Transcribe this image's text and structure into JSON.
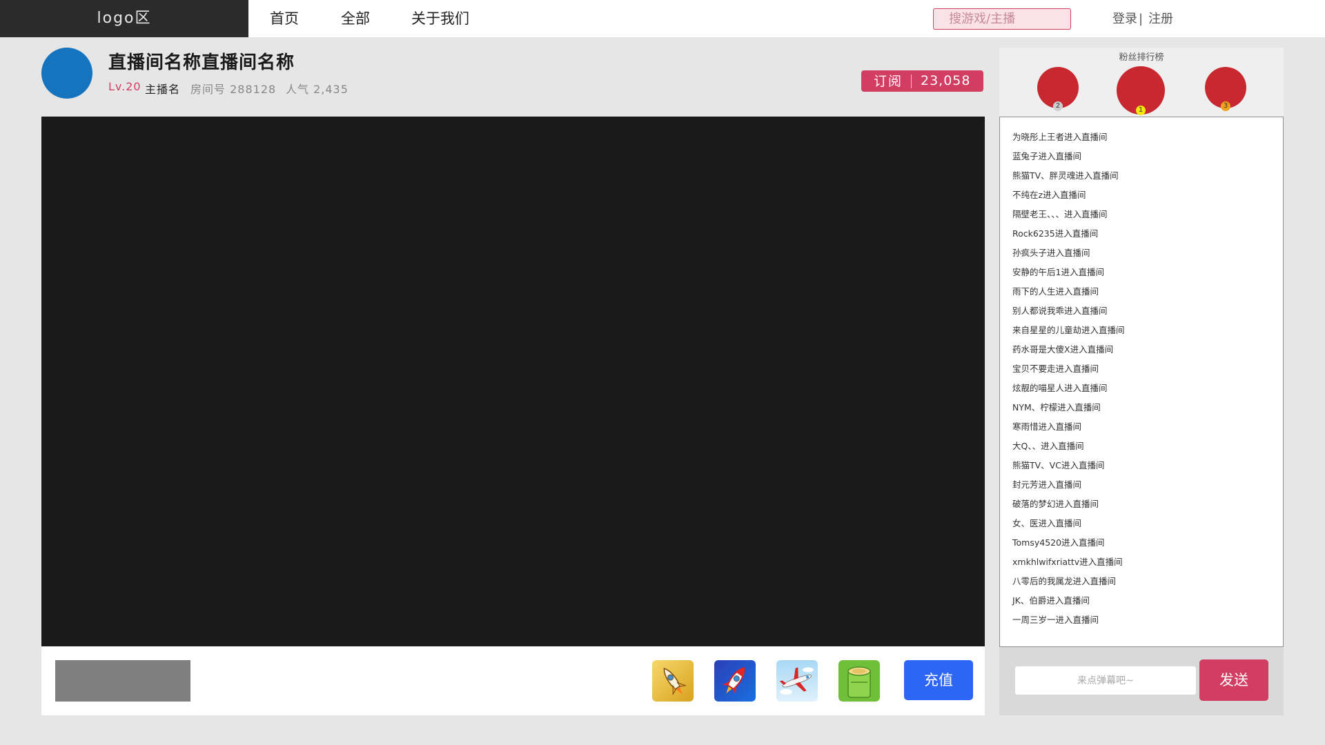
{
  "header": {
    "logo": "logo区",
    "nav": [
      "首页",
      "全部",
      "关于我们"
    ],
    "search_placeholder": "搜游戏/主播",
    "login": "登录",
    "separator": "|",
    "register": "注册"
  },
  "room": {
    "title": "直播间名称直播间名称",
    "level": "Lv.20",
    "anchor": "主播名",
    "room_no_label": "房间号",
    "room_no": "288128",
    "popularity_label": "人气",
    "popularity": "2,435",
    "subscribe_label": "订阅",
    "subscribe_count": "23,058"
  },
  "bottom": {
    "gifts": [
      "rocket-gold-icon",
      "rocket-blue-icon",
      "airplane-icon",
      "bamboo-icon"
    ],
    "recharge_label": "充值"
  },
  "fans": {
    "title": "粉丝排行榜",
    "ranks": [
      "2",
      "1",
      "3"
    ]
  },
  "messages": [
    "为晓彤上王者进入直播间",
    "蓝兔子进入直播间",
    "熊猫TV、胖灵魂进入直播间",
    "不纯在z进入直播间",
    "隔壁老王、、、进入直播间",
    " Rock6235进入直播间",
    "孙疯头子进入直播间",
    "安静的午后1进入直播间",
    "雨下的人生进入直播间",
    "别人都说我乖进入直播间",
    "来自星星的儿童劫进入直播间",
    " 药水哥是大傻X进入直播间",
    " 宝贝不要走进入直播间",
    "炫靓的喵星人进入直播间",
    "NYM、柠檬进入直播间",
    "寒雨惜进入直播间",
    " 大Q、、进入直播间",
    " 熊猫TV、VC进入直播间",
    "封元芳进入直播间",
    "破落的梦幻进入直播间",
    "女、医进入直播间",
    " Tomsy4520进入直播间",
    "xmkhlwifxriattv进入直播间",
    "八零后的我属龙进入直播间",
    " JK、伯爵进入直播间",
    " 一周三岁一进入直播间"
  ],
  "chat": {
    "placeholder": "来点弹幕吧~",
    "send_label": "发送"
  },
  "colors": {
    "accent": "#d23d62",
    "primary_blue": "#2d66f5",
    "video_bg": "#1a1a1a",
    "nav_dark": "#2b2b2b"
  }
}
